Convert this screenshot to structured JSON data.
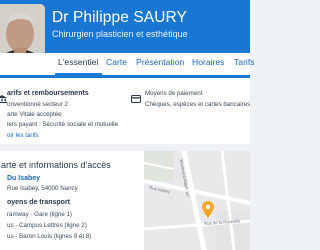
{
  "header": {
    "doctor_name": "Dr Philippe SAURY",
    "specialty": "Chirurgien plasticien et esthétique"
  },
  "tabs": [
    {
      "label": "L'essentiel"
    },
    {
      "label": "Carte"
    },
    {
      "label": "Présentation"
    },
    {
      "label": "Horaires"
    },
    {
      "label": "Tarifs"
    }
  ],
  "fees": {
    "title": "arifs et remboursements",
    "lines": [
      "onventionné secteur 2",
      "arte Vitale acceptée",
      "iers payant : Sécurité sociale et mutuelle"
    ],
    "link": "oir les tarifs"
  },
  "payment": {
    "title": "Moyens de paiement",
    "text": "Chèques, espèces et cartes bancaires"
  },
  "access": {
    "title": "arte et informations d'accès",
    "place_name": "Du Isabey",
    "address": "Rue Isabey, 54000 Nancy",
    "transport_title": "oyens de transport",
    "transport_lines": [
      "ramway - Gare (ligne 1)",
      "us - Campus Lettres (ligne 2)",
      "us - Baron Louis (lignes 9 et 8)"
    ]
  },
  "map": {
    "streets": [
      "Boulevard Albert 1er",
      "Rue Isabey",
      "Rue de la Ravinelle"
    ]
  },
  "colors": {
    "brand_blue": "#1976d2",
    "link_blue": "#1c67bf",
    "map_pin": "#f5a623"
  },
  "icons": {
    "fees": "bank-icon",
    "payment": "card-icon",
    "location": "pin-icon"
  }
}
